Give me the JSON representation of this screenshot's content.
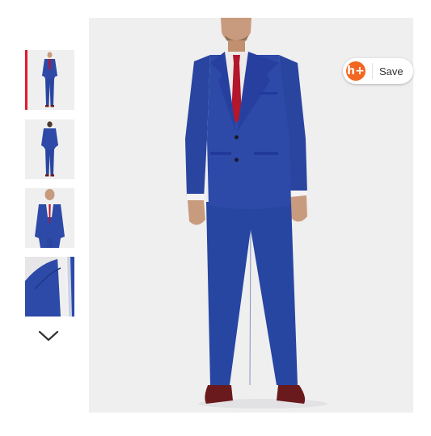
{
  "gallery": {
    "thumbnails": [
      {
        "name": "thumbnail-front",
        "active": true
      },
      {
        "name": "thumbnail-back",
        "active": false
      },
      {
        "name": "thumbnail-detail",
        "active": false
      },
      {
        "name": "thumbnail-closeup",
        "active": false
      }
    ],
    "next_icon": "chevron-down-icon"
  },
  "hero": {
    "save_button": {
      "label": "Save",
      "logo_glyph": "h+",
      "logo_color": "#f26722"
    }
  },
  "colors": {
    "active_indicator": "#e01a2b",
    "suit_blue": "#2d4aa8",
    "tie_red": "#b3172c",
    "shoe_burgundy": "#6a1a1c",
    "background": "#efeff0"
  }
}
